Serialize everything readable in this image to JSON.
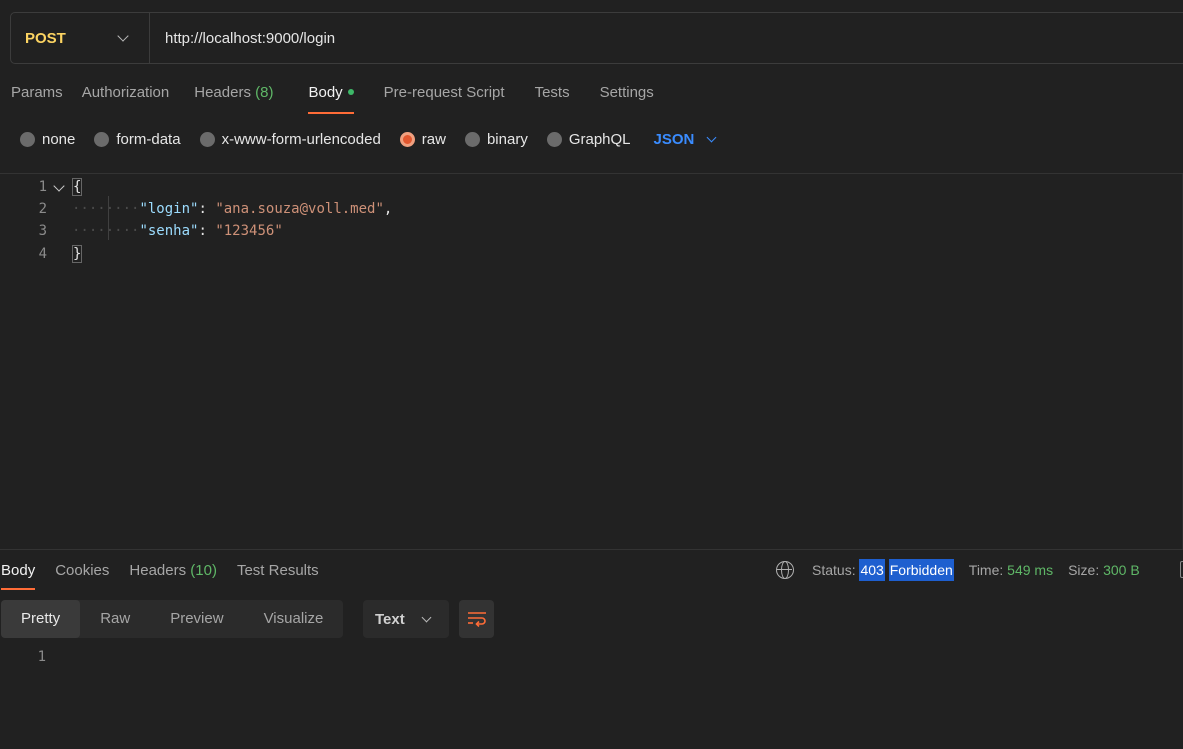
{
  "request": {
    "method": "POST",
    "url": "http://localhost:9000/login"
  },
  "req_tabs": [
    {
      "label": "Params"
    },
    {
      "label": "Authorization"
    },
    {
      "label": "Headers",
      "count": "(8)"
    },
    {
      "label": "Body"
    },
    {
      "label": "Pre-request Script"
    },
    {
      "label": "Tests"
    },
    {
      "label": "Settings"
    }
  ],
  "body_types": [
    "none",
    "form-data",
    "x-www-form-urlencoded",
    "raw",
    "binary",
    "GraphQL"
  ],
  "body_language": "JSON",
  "editor": {
    "lines": [
      "1",
      "2",
      "3",
      "4"
    ],
    "open_brace": "{",
    "close_brace": "}",
    "key1": "\"login\"",
    "val1": "\"ana.souza@voll.med\"",
    "key2": "\"senha\"",
    "val2": "\"123456\"",
    "colon": ": ",
    "comma": ",",
    "indent": "········"
  },
  "response": {
    "tabs": [
      {
        "label": "Body"
      },
      {
        "label": "Cookies"
      },
      {
        "label": "Headers",
        "count": "(10)"
      },
      {
        "label": "Test Results"
      }
    ],
    "status_label": "Status:",
    "status_code": "403",
    "status_text": "Forbidden",
    "time_label": "Time:",
    "time_value": "549 ms",
    "size_label": "Size:",
    "size_value": "300 B",
    "view_modes": [
      "Pretty",
      "Raw",
      "Preview",
      "Visualize"
    ],
    "format": "Text",
    "line": "1"
  },
  "colors": {
    "accent": "#ff6c37",
    "method": "#fcd462",
    "link_blue": "#3a8cff",
    "success_green": "#5fb767",
    "highlight": "#1e5fcf"
  }
}
